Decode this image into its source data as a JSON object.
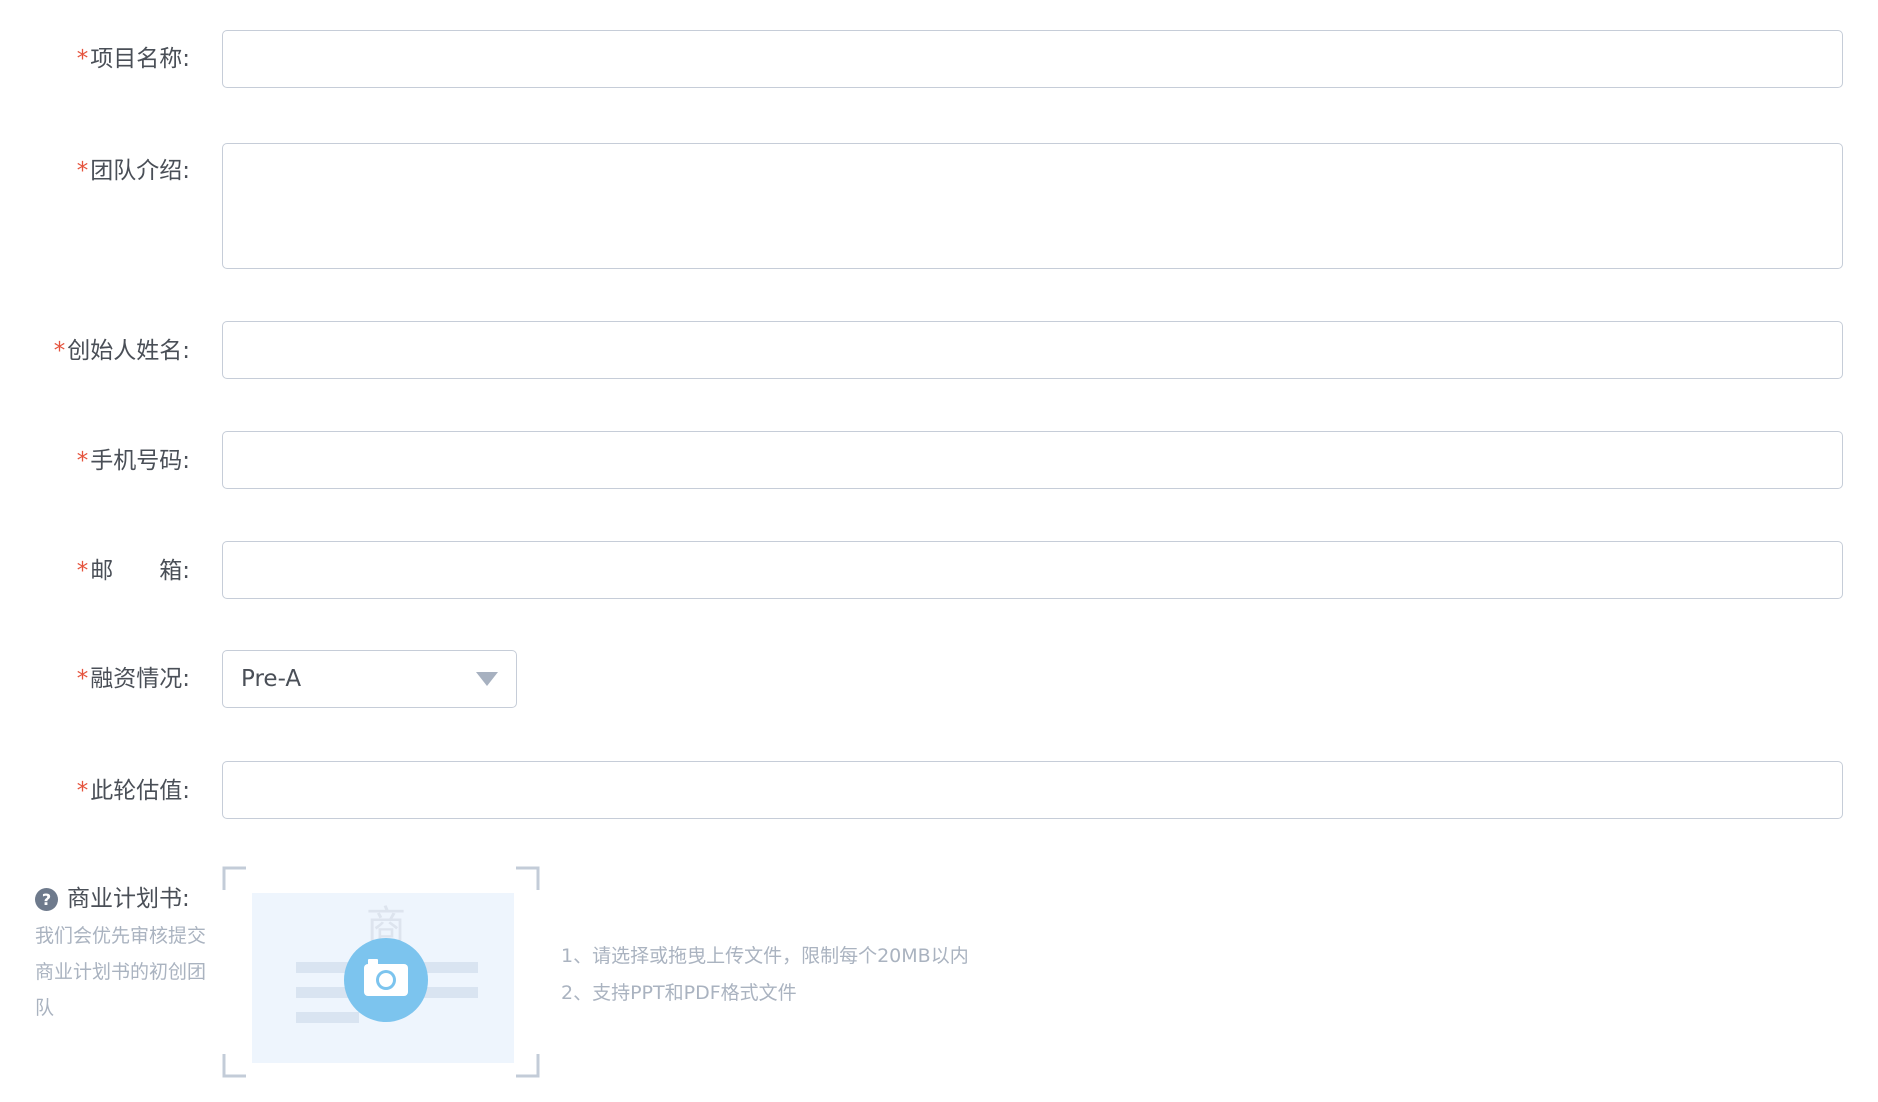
{
  "form": {
    "project_name": {
      "required_mark": "*",
      "label": "项目名称:",
      "value": ""
    },
    "team_intro": {
      "required_mark": "*",
      "label": "团队介绍:",
      "value": ""
    },
    "founder_name": {
      "required_mark": "*",
      "label": "创始人姓名:",
      "value": ""
    },
    "phone": {
      "required_mark": "*",
      "label": "手机号码:",
      "value": ""
    },
    "email": {
      "required_mark": "*",
      "label": "邮　　箱:",
      "value": ""
    },
    "financing": {
      "required_mark": "*",
      "label": "融资情况:",
      "selected": "Pre-A"
    },
    "valuation": {
      "required_mark": "*",
      "label": "此轮估值:",
      "value": ""
    },
    "business_plan": {
      "help_icon": "?",
      "label": "商业计划书:",
      "description": "我们会优先审核提交商业计划书的初创团队",
      "placeholder_char": "商",
      "tip_1": "1、请选择或拖曳上传文件，限制每个20MB以内",
      "tip_2": "2、支持PPT和PDF格式文件"
    }
  },
  "colors": {
    "required": "#e5533d",
    "label": "#4a4f57",
    "muted": "#aab3c0",
    "border": "#c6cdd8",
    "upload_bg": "#eef5fd",
    "camera_circle": "#7cc4ee",
    "corner": "#c3ccd8"
  },
  "icons": {
    "dropdown": "caret-down-icon",
    "help": "question-circle-icon",
    "upload": "camera-icon"
  }
}
